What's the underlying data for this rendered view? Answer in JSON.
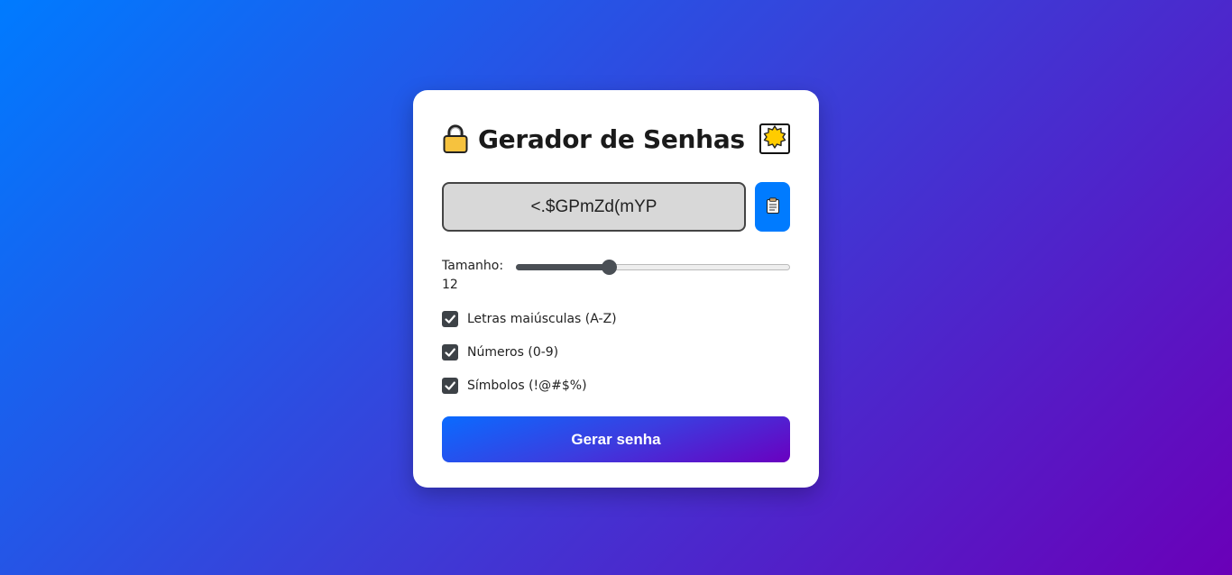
{
  "app": {
    "title": "Gerador de Senhas"
  },
  "password": {
    "value": "<.$GPmZd(mYP"
  },
  "length": {
    "label": "Tamanho:",
    "value": "12",
    "fraction": 0.34
  },
  "options": [
    {
      "label": "Letras maiúsculas (A-Z)",
      "checked": true
    },
    {
      "label": "Números (0-9)",
      "checked": true
    },
    {
      "label": "Símbolos (!@#$%)",
      "checked": true
    }
  ],
  "actions": {
    "generate_label": "Gerar senha"
  },
  "icons": {
    "lock": "lock-icon",
    "theme": "sun-badge-icon",
    "copy": "clipboard-icon",
    "check": "check-icon"
  },
  "colors": {
    "accent": "#007bff",
    "checkbox": "#3d4247",
    "card": "#ffffff"
  }
}
